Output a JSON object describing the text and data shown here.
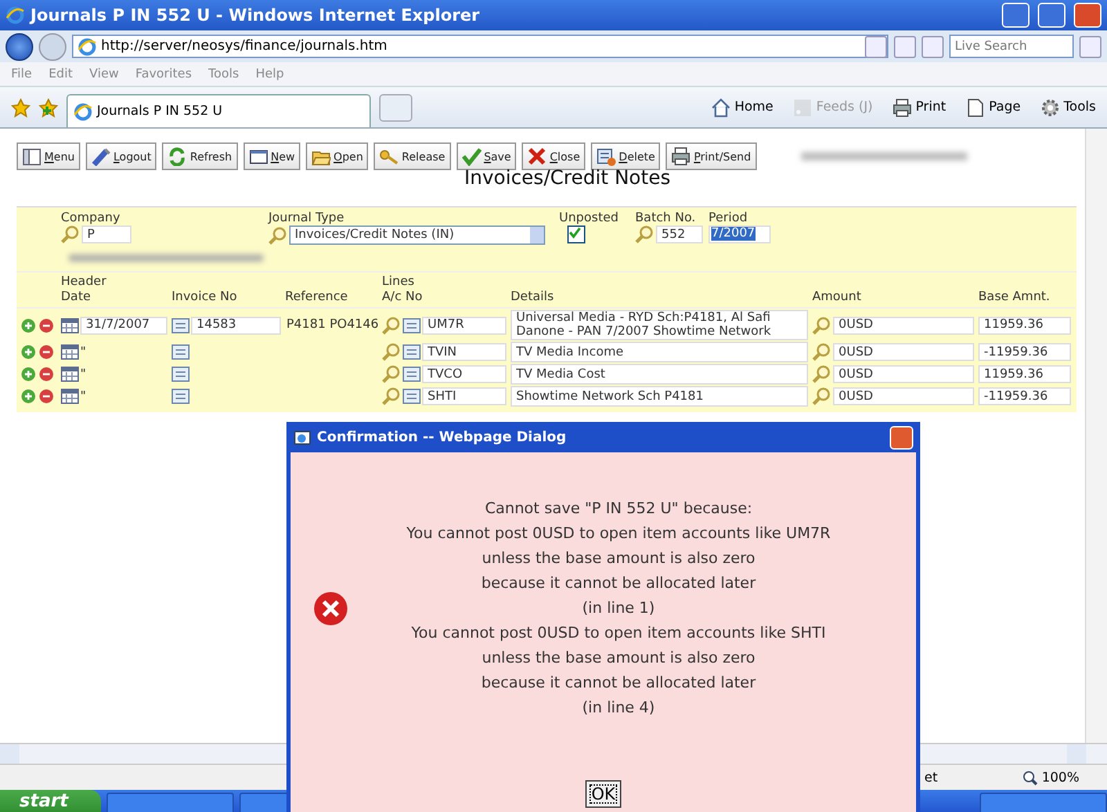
{
  "window": {
    "title": "Journals P IN 552 U - Windows Internet Explorer"
  },
  "browser": {
    "address": "http://server/neosys/finance/journals.htm",
    "search": {
      "placeholder": "Live Search"
    },
    "menu": [
      "File",
      "Edit",
      "View",
      "Favorites",
      "Tools",
      "Help"
    ],
    "tab": {
      "title": "Journals P IN 552 U",
      "selected": true
    },
    "commands": [
      {
        "label": "Home",
        "kind": "home",
        "disabled": false
      },
      {
        "label": "Feeds (J)",
        "kind": "feeds",
        "disabled": true
      },
      {
        "label": "Print",
        "kind": "print",
        "disabled": false
      },
      {
        "label": "Page",
        "kind": "page",
        "disabled": false
      },
      {
        "label": "Tools",
        "kind": "tools",
        "disabled": false
      }
    ]
  },
  "toolbar": [
    {
      "label": "Menu",
      "kind": "menu",
      "underline_first": true
    },
    {
      "label": "Logout",
      "kind": "logout",
      "underline_first": true
    },
    {
      "label": "Refresh",
      "kind": "refresh",
      "underline_first": false
    },
    {
      "label": "New",
      "kind": "new",
      "underline_first": true
    },
    {
      "label": "Open",
      "kind": "open",
      "underline_first": true
    },
    {
      "label": "Release",
      "kind": "release",
      "underline_first": false
    },
    {
      "label": "Save",
      "kind": "save",
      "underline_first": true
    },
    {
      "label": "Close",
      "kind": "close",
      "underline_first": true
    },
    {
      "label": "Delete",
      "kind": "delete",
      "underline_first": true
    },
    {
      "label": "Print/Send",
      "kind": "print",
      "underline_first": true
    }
  ],
  "page_title": "Invoices/Credit Notes",
  "form": {
    "company": {
      "label": "Company",
      "value": "P"
    },
    "journal_type": {
      "label": "Journal Type",
      "value": "Invoices/Credit Notes (IN)"
    },
    "unposted": {
      "label": "Unposted",
      "checked": true
    },
    "batch": {
      "label": "Batch No.",
      "value": "552"
    },
    "period": {
      "label": "Period",
      "value": "7/2007",
      "selected": true
    }
  },
  "grid": {
    "groups": [
      "Header",
      "Lines"
    ],
    "columns": [
      "Date",
      "Invoice No",
      "Reference",
      "A/c No",
      "Details",
      "Amount",
      "Base Amnt."
    ],
    "rows": [
      {
        "date": "31/7/2007",
        "invoice_no": "14583",
        "reference": "P4181 PO4146",
        "account": "UM7R",
        "details": "Universal Media - RYD Sch:P4181, Al Safi Danone - PAN 7/2007 Showtime Network",
        "amount": "0USD",
        "base_amount": "11959.36"
      },
      {
        "date": "\"",
        "account": "TVIN",
        "details": "TV Media Income",
        "amount": "0USD",
        "base_amount": "-11959.36"
      },
      {
        "date": "\"",
        "account": "TVCO",
        "details": "TV Media Cost",
        "amount": "0USD",
        "base_amount": "11959.36"
      },
      {
        "date": "\"",
        "account": "SHTI",
        "details": "Showtime Network Sch P4181",
        "amount": "0USD",
        "base_amount": "-11959.36"
      }
    ]
  },
  "dialog": {
    "title": "Confirmation -- Webpage Dialog",
    "lines": [
      "Cannot save \"P IN 552 U\" because:",
      "You cannot post 0USD to open item accounts like UM7R",
      "unless the base amount is also zero",
      "because it cannot be allocated later",
      "(in line 1)",
      "You cannot post 0USD to open item accounts like SHTI",
      "unless the base amount is also zero",
      "because it cannot be allocated later",
      "(in line 4)"
    ],
    "button": "OK"
  },
  "status_bar": {
    "text": "et",
    "zoom": "100%"
  },
  "taskbar": {
    "start": "start"
  }
}
